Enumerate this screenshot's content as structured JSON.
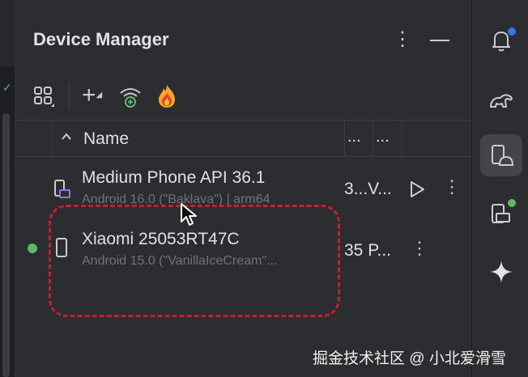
{
  "panel": {
    "title": "Device Manager"
  },
  "table": {
    "columns": [
      "Name",
      "...",
      "..."
    ]
  },
  "devices": [
    {
      "name": "Medium Phone API 36.1",
      "subtitle": "Android 16.0 (\"Baklava\") | arm64",
      "col2": "3...V...",
      "connected": false
    },
    {
      "name": "Xiaomi 25053RT47C",
      "subtitle": "Android 15.0 (\"VanillaIceCream\"...",
      "col2": "35 P...",
      "connected": true
    }
  ],
  "watermark": "掘金技术社区 @ 小北爱滑雪",
  "colors": {
    "accent": "#3574f0",
    "status_green": "#5fb865",
    "highlight_dashed": "#c2202a",
    "firebase_orange": "#f5a623"
  },
  "icons": {
    "toolbar": [
      "device-grid-icon",
      "add-icon",
      "wifi-pairing-icon",
      "firebase-icon"
    ],
    "right_strip": [
      "notifications-icon",
      "gradle-icon",
      "device-manager-icon",
      "running-devices-icon",
      "gemini-icon"
    ]
  }
}
